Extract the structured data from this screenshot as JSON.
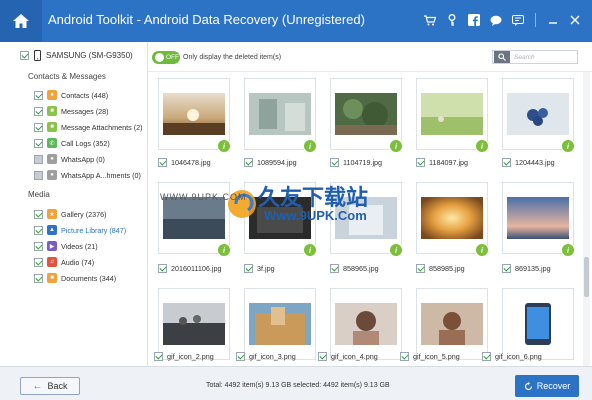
{
  "window": {
    "title": "Android Toolkit - Android Data Recovery (Unregistered)",
    "icons": [
      "cart-icon",
      "key-icon",
      "facebook-icon",
      "chat-icon",
      "feedback-icon",
      "minimize-icon",
      "close-icon"
    ]
  },
  "sidebar": {
    "device": "SAMSUNG (SM-G9350)",
    "sections": [
      {
        "title": "Contacts & Messages",
        "items": [
          {
            "label": "Contacts (448)",
            "icon": "contacts-icon",
            "color": "#f0a23b",
            "checked": true
          },
          {
            "label": "Messages (28)",
            "icon": "messages-icon",
            "color": "#8bc34a",
            "checked": true
          },
          {
            "label": "Message Attachments (2)",
            "icon": "attachment-icon",
            "color": "#8bc34a",
            "checked": true
          },
          {
            "label": "Call Logs (352)",
            "icon": "call-logs-icon",
            "color": "#5cb85c",
            "checked": true
          },
          {
            "label": "WhatsApp (0)",
            "icon": "whatsapp-icon",
            "color": "#9e9e9e",
            "checked": false
          },
          {
            "label": "WhatsApp A...hments (0)",
            "icon": "whatsapp-attachments-icon",
            "color": "#9e9e9e",
            "checked": false
          }
        ]
      },
      {
        "title": "Media",
        "items": [
          {
            "label": "Gallery (2376)",
            "icon": "gallery-icon",
            "color": "#f0a23b",
            "checked": true
          },
          {
            "label": "Picture Library (847)",
            "icon": "picture-library-icon",
            "color": "#2c73c6",
            "checked": true,
            "active": true
          },
          {
            "label": "Videos (21)",
            "icon": "videos-icon",
            "color": "#7b5cc4",
            "checked": true
          },
          {
            "label": "Audio (74)",
            "icon": "audio-icon",
            "color": "#e0533d",
            "checked": true
          },
          {
            "label": "Documents (344)",
            "icon": "documents-icon",
            "color": "#f0a23b",
            "checked": true
          }
        ]
      }
    ]
  },
  "toolbar": {
    "toggle_state": "OFF",
    "toggle_label": "Only display the deleted item(s)",
    "search_placeholder": "Search"
  },
  "files": [
    {
      "name": "1046478.jpg"
    },
    {
      "name": "1089594.jpg"
    },
    {
      "name": "1104719.jpg"
    },
    {
      "name": "1184097.jpg"
    },
    {
      "name": "1204443.jpg"
    },
    {
      "name": "2016011106.jpg"
    },
    {
      "name": "3f.jpg"
    },
    {
      "name": "858965.jpg"
    },
    {
      "name": "858985.jpg"
    },
    {
      "name": "869135.jpg"
    },
    {
      "name": "gif_icon_2.png"
    },
    {
      "name": "gif_icon_3.png"
    },
    {
      "name": "gif_icon_4.png"
    },
    {
      "name": "gif_icon_5.png"
    },
    {
      "name": "gif_icon_6.png"
    }
  ],
  "watermark": {
    "chinese": "久友下载站",
    "url": "Www.9UPK.Com",
    "small": "WWW.9UPK.COM"
  },
  "footer": {
    "back_label": "Back",
    "status": "Total: 4492 item(s) 9.13 GB   selected: 4492 item(s) 9.13 GB",
    "recover_label": "Recover"
  },
  "colors": {
    "titlebar": "#2c73c6",
    "accent_green": "#7bbf3a",
    "recover": "#2c73c6"
  }
}
